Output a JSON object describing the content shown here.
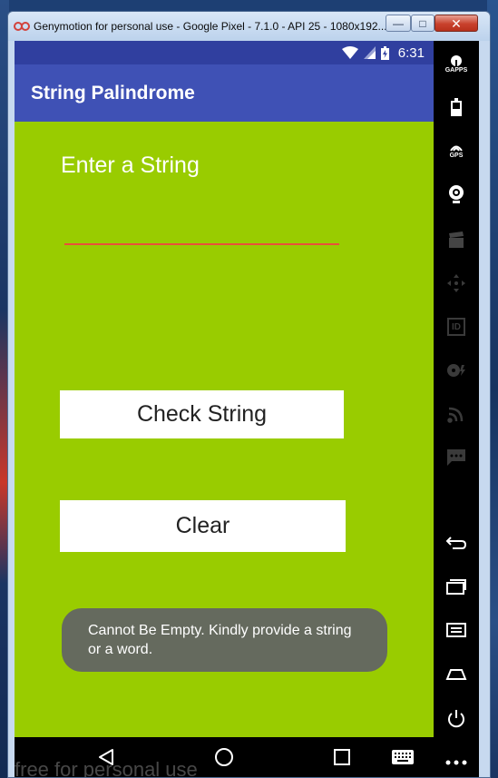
{
  "window": {
    "title": "Genymotion for personal use - Google Pixel - 7.1.0 - API 25 - 1080x192...",
    "minimize_glyph": "—",
    "maximize_glyph": "□",
    "close_glyph": "✕"
  },
  "status_bar": {
    "time": "6:31"
  },
  "app_bar": {
    "title": "String Palindrome"
  },
  "main": {
    "prompt": "Enter a String",
    "input_value": "",
    "check_button_label": "Check String",
    "clear_button_label": "Clear",
    "toast_message": "Cannot Be Empty. Kindly provide a string or a word."
  },
  "watermark": "free for personal use",
  "sidebar": {
    "gapps_label": "GAPPS",
    "gps_label": "GPS",
    "id_label": "ID",
    "items": [
      "gapps",
      "battery",
      "gps",
      "camera",
      "media",
      "dpad",
      "identifiers",
      "disk-io",
      "network",
      "sms",
      "back",
      "recents",
      "menu",
      "home",
      "power",
      "more"
    ]
  },
  "colors": {
    "status_bar": "#303f9f",
    "app_bar": "#3f51b5",
    "content_bg": "#99cc00",
    "input_underline": "#e9503a",
    "toast_bg": "#656a5e"
  },
  "icons": {
    "status": [
      "wifi-icon",
      "cell-signal-icon",
      "battery-charging-icon"
    ],
    "nav": [
      "back-icon",
      "home-icon",
      "recents-icon",
      "keyboard-icon"
    ]
  }
}
